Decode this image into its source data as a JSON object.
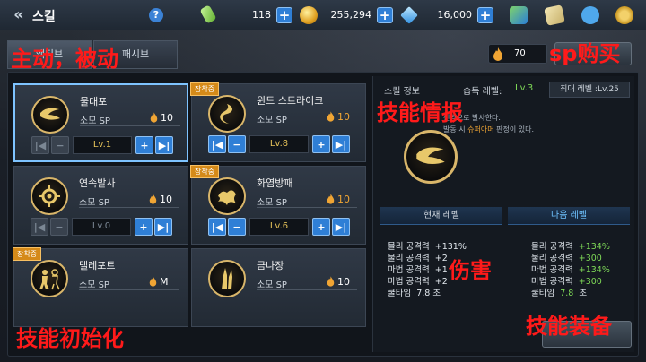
{
  "header": {
    "back_label": "«",
    "title": "스킬",
    "help_label": "?"
  },
  "resources": [
    {
      "name": "stamina",
      "value": "118",
      "icon": "tablet-icon",
      "color": "#9be36a"
    },
    {
      "name": "gold",
      "value": "255,294",
      "icon": "coin-icon",
      "color": "#f0c030"
    },
    {
      "name": "gem",
      "value": "16,000",
      "icon": "diamond-icon",
      "color": "#5ab6ff"
    }
  ],
  "tabs": [
    {
      "label": "액티브"
    },
    {
      "label": "패시브"
    }
  ],
  "sp": {
    "value": "70"
  },
  "annotations": {
    "tab_active": "主动，被动",
    "sp_buy": "sp购买",
    "skill_info": "技能情报",
    "damage": "伤害",
    "reset": "技能初始化",
    "equip": "技能装备"
  },
  "skills": [
    {
      "name": "물대포",
      "sp_label": "소모 SP",
      "sp": "10",
      "level": "Lv.1",
      "badge": "",
      "locked": false,
      "selected": true
    },
    {
      "name": "윈드 스트라이크",
      "sp_label": "소모 SP",
      "sp": "10",
      "level": "Lv.8",
      "badge": "장착중",
      "locked": true,
      "selected": false
    },
    {
      "name": "연속발사",
      "sp_label": "소모 SP",
      "sp": "10",
      "level": "Lv.0",
      "badge": "",
      "locked": false,
      "selected": false
    },
    {
      "name": "화염방패",
      "sp_label": "소모 SP",
      "sp": "10",
      "level": "Lv.6",
      "badge": "장착중",
      "locked": true,
      "selected": false
    },
    {
      "name": "텔레포트",
      "sp_label": "소모 SP",
      "sp": "M",
      "level": "",
      "badge": "장착중",
      "locked": false,
      "selected": false
    },
    {
      "name": "금나장",
      "sp_label": "소모 SP",
      "sp": "10",
      "level": "",
      "badge": "",
      "locked": false,
      "selected": false
    }
  ],
  "info": {
    "title": "스킬 정보",
    "acq_label": "습득 레벨:",
    "acq_value": "Lv.3",
    "max_level": "최대 레벨 :Lv.25",
    "desc_line1": "전방으로 발사한다.",
    "desc_line2_a": "발동 시 ",
    "desc_line2_b": "슈퍼아머",
    "desc_line2_c": " 판정이 있다.",
    "current_label": "현재 레벨",
    "next_label": "다음 레벨",
    "current_stats": [
      {
        "k": "물리 공격력",
        "v": "+131%"
      },
      {
        "k": "물리 공격력",
        "v": "+2"
      },
      {
        "k": "마법 공격력",
        "v": "+1"
      },
      {
        "k": "마법 공격력",
        "v": "+2"
      },
      {
        "k": "쿨타임",
        "v": "7.8 초"
      }
    ],
    "next_stats": [
      {
        "k": "물리 공격력",
        "v": "+134%"
      },
      {
        "k": "물리 공격력",
        "v": "+300"
      },
      {
        "k": "마법 공격력",
        "v": "+134%"
      },
      {
        "k": "마법 공격력",
        "v": "+300"
      },
      {
        "k": "쿨타임",
        "v": "7.8",
        "u": "초"
      }
    ]
  }
}
